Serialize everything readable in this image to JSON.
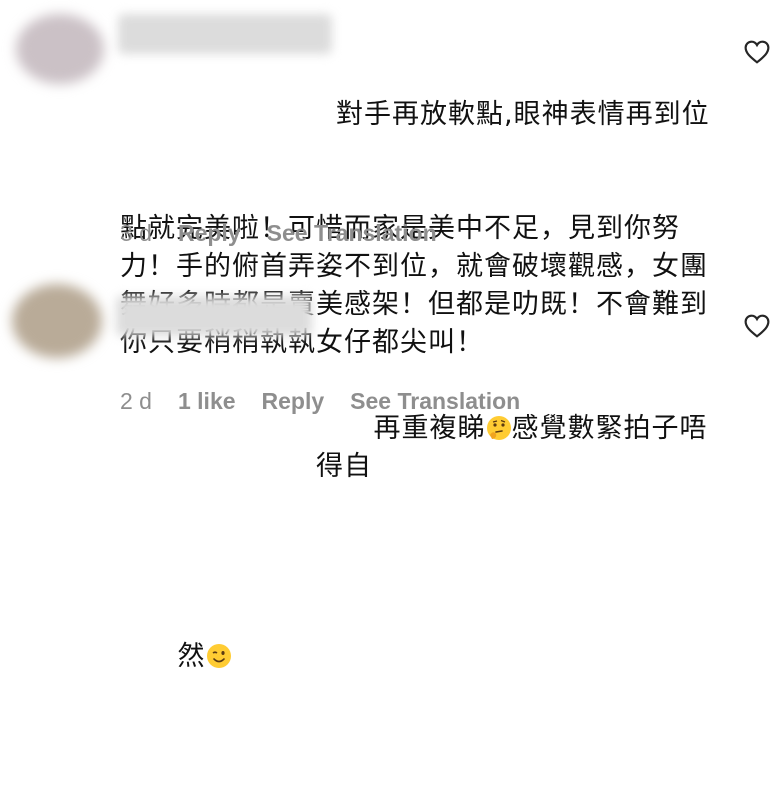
{
  "comments": [
    {
      "text_line_1": "對手再放軟點,眼神表情再到位",
      "text_rest": "點就完美啦！可惜而家是美中不足，見到你努力！手的俯首弄姿不到位，就會破壞觀感，女團舞好多時都是賣美感架！但都是叻既！不會難到你只要稍稍執執女仔都尖叫！",
      "time": "3 d",
      "reply_label": "Reply",
      "translate_label": "See Translation",
      "like_icon": "heart-outline-icon"
    },
    {
      "text_line_1_pre": "再重複睇",
      "emoji_1": "thinking-face-emoji",
      "text_line_1_post": "感覺數緊拍子唔得自",
      "text_line_2": "然",
      "emoji_2": "winking-face-emoji",
      "time": "2 d",
      "likes": "1 like",
      "reply_label": "Reply",
      "translate_label": "See Translation",
      "like_icon": "heart-outline-icon"
    }
  ],
  "colors": {
    "text": "#111111",
    "meta": "#8e8e8e",
    "avatar_1": "#c9bfc4",
    "avatar_2": "#b9ab98",
    "username_blur": "#d7d7d7"
  }
}
